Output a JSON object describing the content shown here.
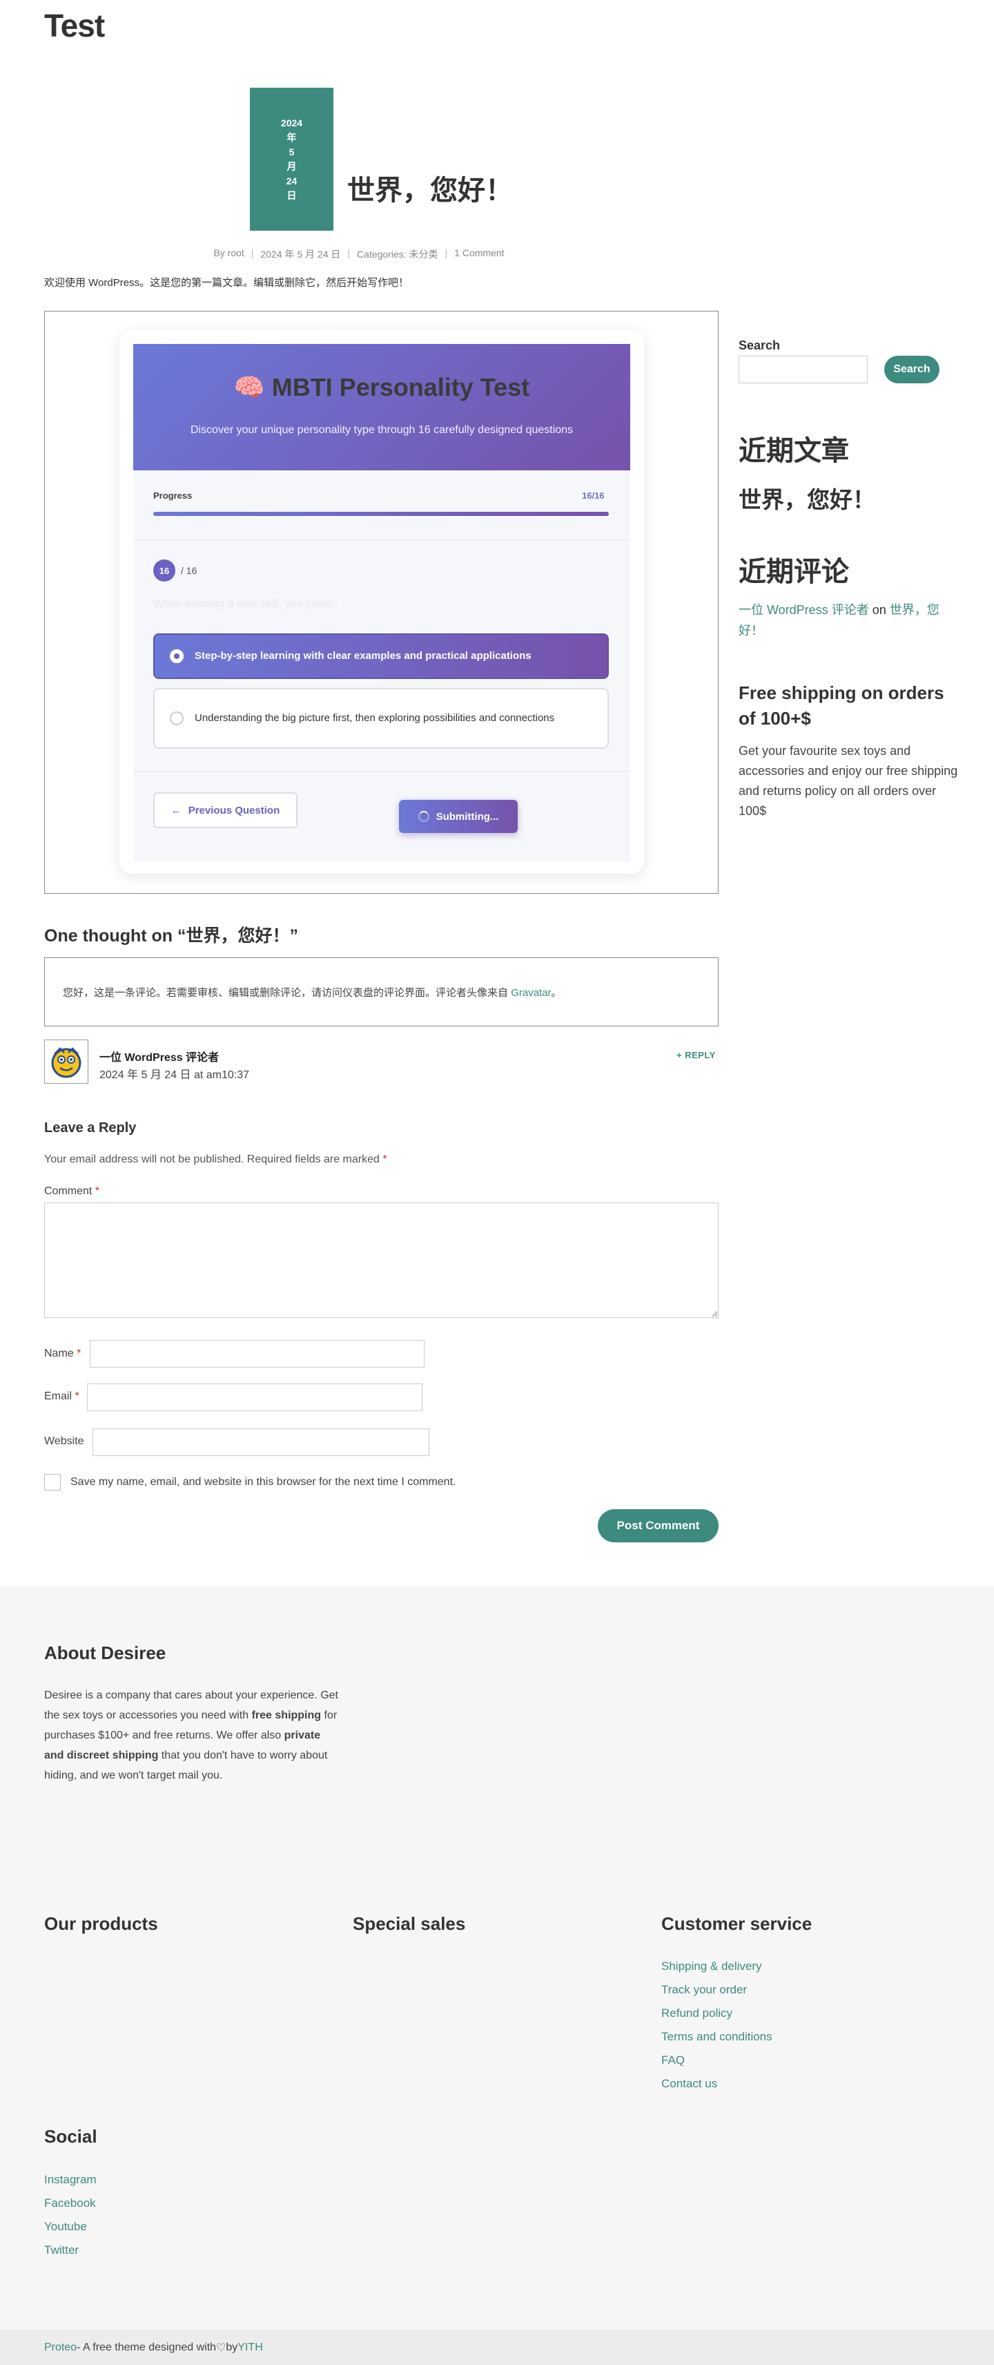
{
  "site": {
    "title": "Test"
  },
  "post": {
    "date_lines": [
      "2024",
      "年",
      "5",
      "月",
      "24",
      "日"
    ],
    "title": "世界，您好！",
    "meta": {
      "author": "By root",
      "date": "2024 年 5 月 24 日",
      "categories": "Categories: 未分类",
      "comments": "1 Comment"
    },
    "intro": "欢迎使用 WordPress。这是您的第一篇文章。编辑或删除它，然后开始写作吧！"
  },
  "quiz": {
    "icon": "brain-icon",
    "emoji": "🧠",
    "title": "MBTI Personality Test",
    "subtitle": "Discover your unique personality type through 16 carefully designed questions",
    "progress_label": "Progress",
    "progress_count": "16/16",
    "progress_fraction": 1.0,
    "question_number": "16",
    "question_total": "/ 16",
    "question_text": "When learning a new skill, you prefer:",
    "options": [
      "Step-by-step learning with clear examples and practical applications",
      "Understanding the big picture first, then exploring possibilities and connections"
    ],
    "selected_option": 0,
    "prev_label": "Previous Question",
    "submit_label": "Submitting...",
    "colors": {
      "gradient_start": "#6c79d8",
      "gradient_end": "#7652ab"
    }
  },
  "sidebar": {
    "search_label": "Search",
    "search_button": "Search",
    "recent_posts_title": "近期文章",
    "recent_post": "世界，您好！",
    "recent_comments_title": "近期评论",
    "recent_comment_author": "一位 WordPress 评论者",
    "recent_comment_on": "on",
    "recent_comment_post": "世界，您好！",
    "shipping_title": "Free shipping on orders of 100+$",
    "shipping_text": "Get your favourite sex toys and accessories and enjoy our free shipping and returns policy on all orders over 100$"
  },
  "comments": {
    "title": "One thought on “世界，您好！”",
    "text": "您好，这是一条评论。若需要审核、编辑或删除评论，请访问仪表盘的评论界面。评论者头像来自 ",
    "gravatar": "Gravatar",
    "text_end": "。",
    "author": "一位 WordPress 评论者",
    "date": "2024 年 5 月 24 日 at am10:37",
    "reply": "+ REPLY"
  },
  "reply_form": {
    "title": "Leave a Reply",
    "notes": "Your email address will not be published. Required fields are marked",
    "required_mark": "*",
    "comment_label": "Comment",
    "name_label": "Name",
    "email_label": "Email",
    "website_label": "Website",
    "save_text": "Save my name, email, and website in this browser for the next time I comment.",
    "submit": "Post Comment"
  },
  "footer": {
    "about_title": "About Desiree",
    "about_text_1": "Desiree is a company that cares about your experience. Get the sex toys or accessories you need with ",
    "about_bold_1": "free shipping",
    "about_text_2": " for purchases $100+ and free returns.  We offer also ",
    "about_bold_2": "private and discreet shipping",
    "about_text_3": " that you don't have to worry about hiding, and we won't target mail you.",
    "products_title": "Our products",
    "sales_title": "Special sales",
    "service_title": "Customer service",
    "service_links": [
      "Shipping & delivery",
      "Track your order",
      "Refund policy",
      "Terms and conditions",
      "FAQ",
      "Contact us"
    ],
    "social_title": "Social",
    "social_links": [
      "Instagram",
      "Facebook",
      "Youtube",
      "Twitter"
    ],
    "credit_link": "Proteo",
    "credit_text": " - A free theme designed with ",
    "credit_heart": "♡",
    "credit_by": " by ",
    "credit_author": "YITH"
  }
}
